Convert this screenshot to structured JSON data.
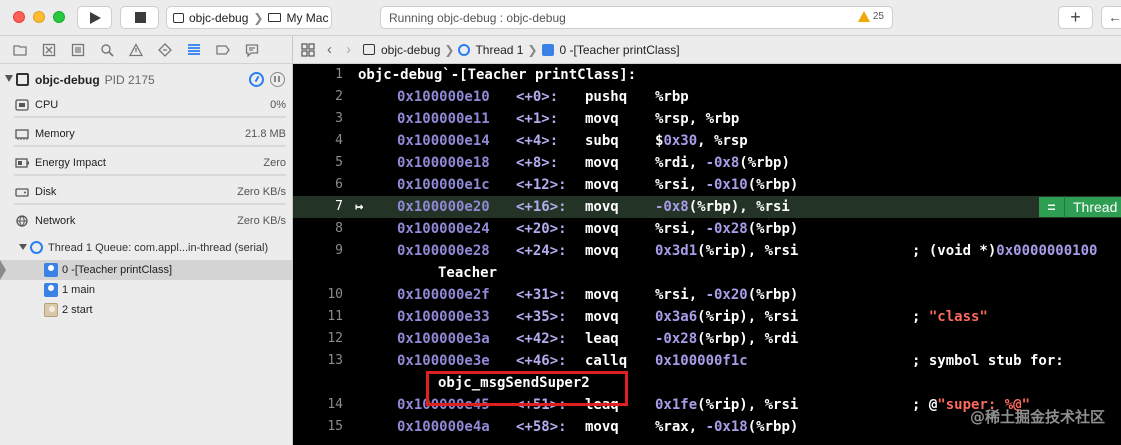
{
  "toolbar": {
    "scheme_target": "objc-debug",
    "scheme_device": "My Mac",
    "status_text": "Running objc-debug : objc-debug",
    "warning_count": "25",
    "add_label": "+",
    "back_label": "←"
  },
  "navigator": {
    "process": {
      "name": "objc-debug",
      "pid": "PID 2175"
    },
    "gauges": [
      {
        "label": "CPU",
        "value": "0%",
        "icon": "cpu-icon"
      },
      {
        "label": "Memory",
        "value": "21.8 MB",
        "icon": "memory-icon"
      },
      {
        "label": "Energy Impact",
        "value": "Zero",
        "icon": "energy-icon"
      },
      {
        "label": "Disk",
        "value": "Zero KB/s",
        "icon": "disk-icon"
      },
      {
        "label": "Network",
        "value": "Zero KB/s",
        "icon": "network-icon"
      }
    ],
    "thread": "Thread 1 Queue: com.appl...in-thread (serial)",
    "frames": [
      {
        "label": "0 -[Teacher printClass]",
        "selected": true
      },
      {
        "label": "1 main",
        "selected": false
      },
      {
        "label": "2 start",
        "selected": false
      }
    ]
  },
  "jumpbar": {
    "target": "objc-debug",
    "thread": "Thread 1",
    "frame": "0 -[Teacher printClass]"
  },
  "code": {
    "header": "objc-debug`-[Teacher printClass]:",
    "current_line": "7",
    "badge": "Thread",
    "watermark": "@稀土掘金技术社区",
    "lines": [
      {
        "ln": "1"
      },
      {
        "ln": "2",
        "addr": "0x100000e10",
        "off": "<+0>:",
        "op": "pushq",
        "args": "%rbp"
      },
      {
        "ln": "3",
        "addr": "0x100000e11",
        "off": "<+1>:",
        "op": "movq",
        "args": "%rsp, %rbp"
      },
      {
        "ln": "4",
        "addr": "0x100000e14",
        "off": "<+4>:",
        "op": "subq",
        "args": "$0x30, %rsp"
      },
      {
        "ln": "5",
        "addr": "0x100000e18",
        "off": "<+8>:",
        "op": "movq",
        "args": "%rdi, -0x8(%rbp)"
      },
      {
        "ln": "6",
        "addr": "0x100000e1c",
        "off": "<+12>:",
        "op": "movq",
        "args": "%rsi, -0x10(%rbp)"
      },
      {
        "ln": "7",
        "addr": "0x100000e20",
        "off": "<+16>:",
        "op": "movq",
        "args": "-0x8(%rbp), %rsi"
      },
      {
        "ln": "8",
        "addr": "0x100000e24",
        "off": "<+20>:",
        "op": "movq",
        "args": "%rsi, -0x28(%rbp)"
      },
      {
        "ln": "9",
        "addr": "0x100000e28",
        "off": "<+24>:",
        "op": "movq",
        "args": "0x3d1(%rip), %rsi",
        "comment": "; (void *)0x0000000100",
        "cont": "Teacher"
      },
      {
        "ln": "10",
        "addr": "0x100000e2f",
        "off": "<+31>:",
        "op": "movq",
        "args": "%rsi, -0x20(%rbp)"
      },
      {
        "ln": "11",
        "addr": "0x100000e33",
        "off": "<+35>:",
        "op": "movq",
        "args": "0x3a6(%rip), %rsi",
        "comment": ";",
        "str": "\"class\""
      },
      {
        "ln": "12",
        "addr": "0x100000e3a",
        "off": "<+42>:",
        "op": "leaq",
        "args": "-0x28(%rbp), %rdi"
      },
      {
        "ln": "13",
        "addr": "0x100000e3e",
        "off": "<+46>:",
        "op": "callq",
        "args": "0x100000f1c",
        "comment": "; symbol stub for:",
        "cont": "objc_msgSendSuper2"
      },
      {
        "ln": "14",
        "addr": "0x100000e45",
        "off": "<+51>:",
        "op": "leaq",
        "args": "0x1fe(%rip), %rsi",
        "comment": "; @",
        "str": "\"super: %@\""
      },
      {
        "ln": "15",
        "addr": "0x100000e4a",
        "off": "<+58>:",
        "op": "movq",
        "args": "%rax, -0x18(%rbp)"
      }
    ]
  }
}
